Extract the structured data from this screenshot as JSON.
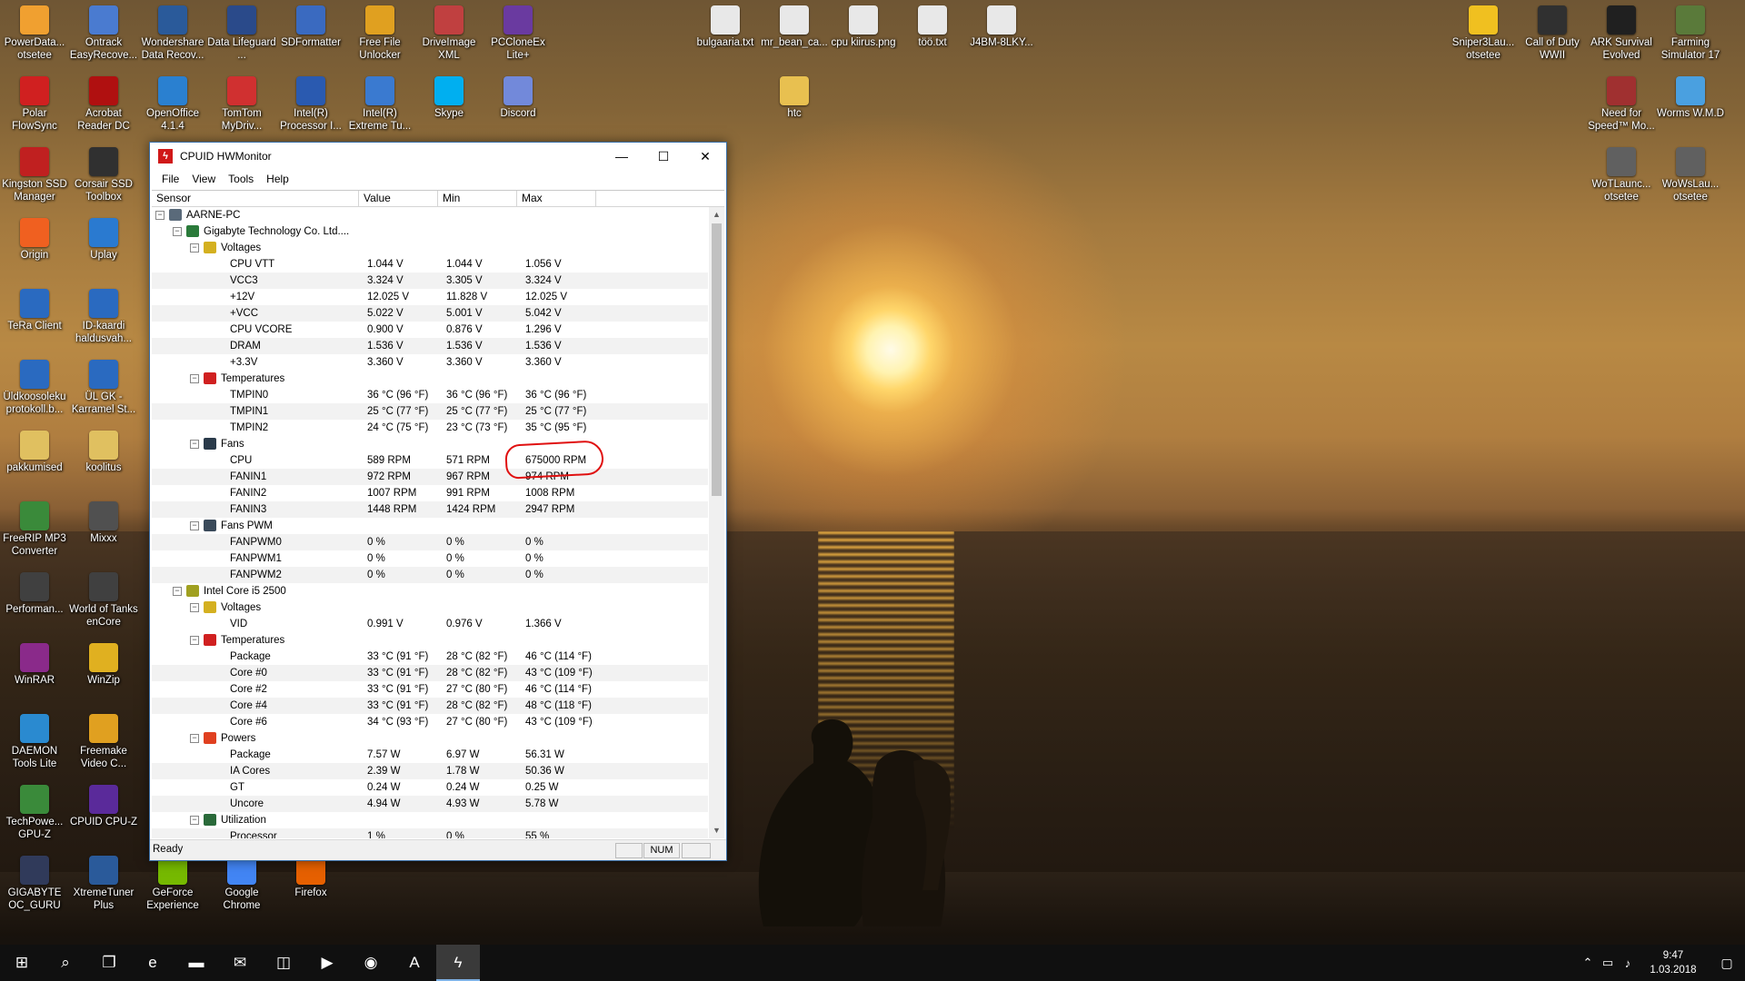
{
  "desktop": {
    "icons": [
      {
        "label": "PowerData... otsetee",
        "icon": "power-data-icon",
        "color": "#f0a030"
      },
      {
        "label": "Ontrack EasyRecove...",
        "icon": "ontrack-icon",
        "color": "#4a7bd0"
      },
      {
        "label": "Wondershare Data Recov...",
        "icon": "wondershare-icon",
        "color": "#2a5a9a"
      },
      {
        "label": "Data Lifeguard ...",
        "icon": "data-lifeguard-icon",
        "color": "#2a4a8a"
      },
      {
        "label": "SDFormatter",
        "icon": "sdformatter-icon",
        "color": "#3a6ac0"
      },
      {
        "label": "Free File Unlocker",
        "icon": "free-file-unlocker-icon",
        "color": "#e0a020"
      },
      {
        "label": "DriveImage XML",
        "icon": "driveimage-icon",
        "color": "#c04040"
      },
      {
        "label": "PCCloneEx Lite+",
        "icon": "pccloneex-icon",
        "color": "#6a3aa0"
      },
      {
        "label": "bulgaaria.txt",
        "icon": "text-file-icon",
        "color": "#e8e8e8"
      },
      {
        "label": "mr_bean_ca...",
        "icon": "document-file-icon",
        "color": "#e8e8e8"
      },
      {
        "label": "cpu kiirus.png",
        "icon": "image-file-icon",
        "color": "#e8e8e8"
      },
      {
        "label": "töö.txt",
        "icon": "text-file-icon",
        "color": "#e8e8e8"
      },
      {
        "label": "J4BM-8LKY...",
        "icon": "text-file-icon",
        "color": "#e8e8e8"
      },
      {
        "label": "Sniper3Lau... otsetee",
        "icon": "sniper-icon",
        "color": "#f0c020"
      },
      {
        "label": "Call of Duty WWII",
        "icon": "call-of-duty-icon",
        "color": "#303030"
      },
      {
        "label": "ARK Survival Evolved",
        "icon": "ark-icon",
        "color": "#202020"
      },
      {
        "label": "Farming Simulator 17",
        "icon": "farming-sim-icon",
        "color": "#5a7a3a"
      },
      {
        "label": "Polar FlowSync",
        "icon": "polar-icon",
        "color": "#d02020"
      },
      {
        "label": "Acrobat Reader DC",
        "icon": "acrobat-icon",
        "color": "#b01010"
      },
      {
        "label": "OpenOffice 4.1.4",
        "icon": "openoffice-icon",
        "color": "#2a80d0"
      },
      {
        "label": "TomTom MyDriv...",
        "icon": "tomtom-icon",
        "color": "#d03030"
      },
      {
        "label": "Intel(R) Processor I...",
        "icon": "intel-icon",
        "color": "#2a5ab0"
      },
      {
        "label": "Intel(R) Extreme Tu...",
        "icon": "intel-xtu-icon",
        "color": "#3a7ad0"
      },
      {
        "label": "Skype",
        "icon": "skype-icon",
        "color": "#00aff0"
      },
      {
        "label": "Discord",
        "icon": "discord-icon",
        "color": "#7289da"
      },
      {
        "label": "htc",
        "icon": "folder-icon",
        "color": "#e8c050"
      },
      {
        "label": "Need for Speed™ Mo...",
        "icon": "nfs-icon",
        "color": "#a03030"
      },
      {
        "label": "Worms W.M.D",
        "icon": "worms-icon",
        "color": "#4aa0e0"
      },
      {
        "label": "Kingston SSD Manager",
        "icon": "kingston-icon",
        "color": "#c02020"
      },
      {
        "label": "Corsair SSD Toolbox",
        "icon": "corsair-icon",
        "color": "#303030"
      },
      {
        "label": "WoTLaunc... otsetee",
        "icon": "wot-icon",
        "color": "#606060"
      },
      {
        "label": "WoWsLau... otsetee",
        "icon": "wows-icon",
        "color": "#606060"
      },
      {
        "label": "Origin",
        "icon": "origin-icon",
        "color": "#f06020"
      },
      {
        "label": "Uplay",
        "icon": "uplay-icon",
        "color": "#2a7ad0"
      },
      {
        "label": "TeRa Client",
        "icon": "id-card-icon",
        "color": "#2a6ac0"
      },
      {
        "label": "ID-kaardi haldusvah...",
        "icon": "id-card-icon",
        "color": "#2a6ac0"
      },
      {
        "label": "Üldkoosoleku protokoll.b...",
        "icon": "id-doc-icon",
        "color": "#2a6ac0"
      },
      {
        "label": "ÜL GK - Karramel St...",
        "icon": "id-doc-icon",
        "color": "#2a6ac0"
      },
      {
        "label": "pakkumised",
        "icon": "archive-icon",
        "color": "#e0c060"
      },
      {
        "label": "koolitus",
        "icon": "folder-icon",
        "color": "#e0c060"
      },
      {
        "label": "FreeRIP MP3 Converter",
        "icon": "freerip-icon",
        "color": "#3a8a3a"
      },
      {
        "label": "Mixxx",
        "icon": "mixxx-icon",
        "color": "#505050"
      },
      {
        "label": "Performan...",
        "icon": "performance-icon",
        "color": "#404040"
      },
      {
        "label": "World of Tanks enCore",
        "icon": "wot-encore-icon",
        "color": "#404040"
      },
      {
        "label": "WinRAR",
        "icon": "winrar-icon",
        "color": "#8a2a8a"
      },
      {
        "label": "WinZip",
        "icon": "winzip-icon",
        "color": "#e0b020"
      },
      {
        "label": "DAEMON Tools Lite",
        "icon": "daemon-tools-icon",
        "color": "#2a8ad0"
      },
      {
        "label": "Freemake Video C...",
        "icon": "freemake-icon",
        "color": "#e0a020"
      },
      {
        "label": "TechPowe... GPU-Z",
        "icon": "gpuz-icon",
        "color": "#3a8a3a"
      },
      {
        "label": "CPUID CPU-Z",
        "icon": "cpuz-icon",
        "color": "#5a2a9a"
      },
      {
        "label": "GIGABYTE OC_GURU",
        "icon": "gigabyte-icon",
        "color": "#303a5a"
      },
      {
        "label": "XtremeTuner Plus",
        "icon": "xtremetuner-icon",
        "color": "#2a5a9a"
      },
      {
        "label": "GeForce Experience",
        "icon": "geforce-icon",
        "color": "#76b900"
      },
      {
        "label": "Google Chrome",
        "icon": "chrome-icon",
        "color": "#4285f4"
      },
      {
        "label": "Firefox",
        "icon": "firefox-icon",
        "color": "#e66000"
      }
    ]
  },
  "window": {
    "title": "CPUID HWMonitor",
    "menu": [
      "File",
      "View",
      "Tools",
      "Help"
    ],
    "columns": [
      "Sensor",
      "Value",
      "Min",
      "Max"
    ],
    "rows": [
      {
        "level": 0,
        "exp": "-",
        "icon": "computer-icon",
        "name": "AARNE-PC",
        "value": "",
        "min": "",
        "max": ""
      },
      {
        "level": 1,
        "exp": "-",
        "icon": "motherboard-icon",
        "name": "Gigabyte Technology Co. Ltd....",
        "value": "",
        "min": "",
        "max": ""
      },
      {
        "level": 2,
        "exp": "-",
        "icon": "voltage-icon",
        "name": "Voltages",
        "value": "",
        "min": "",
        "max": ""
      },
      {
        "level": 3,
        "name": "CPU VTT",
        "value": "1.044 V",
        "min": "1.044 V",
        "max": "1.056 V"
      },
      {
        "level": 3,
        "name": "VCC3",
        "value": "3.324 V",
        "min": "3.305 V",
        "max": "3.324 V"
      },
      {
        "level": 3,
        "name": "+12V",
        "value": "12.025 V",
        "min": "11.828 V",
        "max": "12.025 V"
      },
      {
        "level": 3,
        "name": "+VCC",
        "value": "5.022 V",
        "min": "5.001 V",
        "max": "5.042 V"
      },
      {
        "level": 3,
        "name": "CPU VCORE",
        "value": "0.900 V",
        "min": "0.876 V",
        "max": "1.296 V"
      },
      {
        "level": 3,
        "name": "DRAM",
        "value": "1.536 V",
        "min": "1.536 V",
        "max": "1.536 V"
      },
      {
        "level": 3,
        "name": "+3.3V",
        "value": "3.360 V",
        "min": "3.360 V",
        "max": "3.360 V"
      },
      {
        "level": 2,
        "exp": "-",
        "icon": "thermometer-icon",
        "name": "Temperatures",
        "value": "",
        "min": "",
        "max": ""
      },
      {
        "level": 3,
        "name": "TMPIN0",
        "value": "36 °C  (96 °F)",
        "min": "36 °C  (96 °F)",
        "max": "36 °C  (96 °F)"
      },
      {
        "level": 3,
        "name": "TMPIN1",
        "value": "25 °C  (77 °F)",
        "min": "25 °C  (77 °F)",
        "max": "25 °C  (77 °F)"
      },
      {
        "level": 3,
        "name": "TMPIN2",
        "value": "24 °C  (75 °F)",
        "min": "23 °C  (73 °F)",
        "max": "35 °C  (95 °F)"
      },
      {
        "level": 2,
        "exp": "-",
        "icon": "fan-icon",
        "name": "Fans",
        "value": "",
        "min": "",
        "max": ""
      },
      {
        "level": 3,
        "name": "CPU",
        "value": "589 RPM",
        "min": "571 RPM",
        "max": "675000 RPM"
      },
      {
        "level": 3,
        "name": "FANIN1",
        "value": "972 RPM",
        "min": "967 RPM",
        "max": "974 RPM"
      },
      {
        "level": 3,
        "name": "FANIN2",
        "value": "1007 RPM",
        "min": "991 RPM",
        "max": "1008 RPM"
      },
      {
        "level": 3,
        "name": "FANIN3",
        "value": "1448 RPM",
        "min": "1424 RPM",
        "max": "2947 RPM"
      },
      {
        "level": 2,
        "exp": "-",
        "icon": "fan-pwm-icon",
        "name": "Fans PWM",
        "value": "",
        "min": "",
        "max": ""
      },
      {
        "level": 3,
        "name": "FANPWM0",
        "value": "0 %",
        "min": "0 %",
        "max": "0 %"
      },
      {
        "level": 3,
        "name": "FANPWM1",
        "value": "0 %",
        "min": "0 %",
        "max": "0 %"
      },
      {
        "level": 3,
        "name": "FANPWM2",
        "value": "0 %",
        "min": "0 %",
        "max": "0 %"
      },
      {
        "level": 1,
        "exp": "-",
        "icon": "cpu-chip-icon",
        "name": "Intel Core i5 2500",
        "value": "",
        "min": "",
        "max": ""
      },
      {
        "level": 2,
        "exp": "-",
        "icon": "voltage-icon",
        "name": "Voltages",
        "value": "",
        "min": "",
        "max": ""
      },
      {
        "level": 3,
        "name": "VID",
        "value": "0.991 V",
        "min": "0.976 V",
        "max": "1.366 V"
      },
      {
        "level": 2,
        "exp": "-",
        "icon": "thermometer-icon",
        "name": "Temperatures",
        "value": "",
        "min": "",
        "max": ""
      },
      {
        "level": 3,
        "name": "Package",
        "value": "33 °C  (91 °F)",
        "min": "28 °C  (82 °F)",
        "max": "46 °C  (114 °F)"
      },
      {
        "level": 3,
        "name": "Core #0",
        "value": "33 °C  (91 °F)",
        "min": "28 °C  (82 °F)",
        "max": "43 °C  (109 °F)"
      },
      {
        "level": 3,
        "name": "Core #2",
        "value": "33 °C  (91 °F)",
        "min": "27 °C  (80 °F)",
        "max": "46 °C  (114 °F)"
      },
      {
        "level": 3,
        "name": "Core #4",
        "value": "33 °C  (91 °F)",
        "min": "28 °C  (82 °F)",
        "max": "48 °C  (118 °F)"
      },
      {
        "level": 3,
        "name": "Core #6",
        "value": "34 °C  (93 °F)",
        "min": "27 °C  (80 °F)",
        "max": "43 °C  (109 °F)"
      },
      {
        "level": 2,
        "exp": "-",
        "icon": "power-icon",
        "name": "Powers",
        "value": "",
        "min": "",
        "max": ""
      },
      {
        "level": 3,
        "name": "Package",
        "value": "7.57 W",
        "min": "6.97 W",
        "max": "56.31 W"
      },
      {
        "level": 3,
        "name": "IA Cores",
        "value": "2.39 W",
        "min": "1.78 W",
        "max": "50.36 W"
      },
      {
        "level": 3,
        "name": "GT",
        "value": "0.24 W",
        "min": "0.24 W",
        "max": "0.25 W"
      },
      {
        "level": 3,
        "name": "Uncore",
        "value": "4.94 W",
        "min": "4.93 W",
        "max": "5.78 W"
      },
      {
        "level": 2,
        "exp": "-",
        "icon": "utilization-icon",
        "name": "Utilization",
        "value": "",
        "min": "",
        "max": ""
      },
      {
        "level": 3,
        "name": "Processor",
        "value": "1 %",
        "min": "0 %",
        "max": "55 %"
      }
    ],
    "status": "Ready",
    "status_num": "NUM",
    "icon_colors": {
      "computer-icon": "#5a6a7a",
      "motherboard-icon": "#2a7a3a",
      "voltage-icon": "#d4b020",
      "thermometer-icon": "#d02020",
      "fan-icon": "#2a3a4a",
      "fan-pwm-icon": "#3a4a5a",
      "cpu-chip-icon": "#a0a020",
      "power-icon": "#e04020",
      "utilization-icon": "#2a6a3a"
    },
    "annotation_color": "#e01010"
  },
  "taskbar": {
    "items": [
      {
        "name": "start-button",
        "glyph": "⊞"
      },
      {
        "name": "search-icon",
        "glyph": "⌕"
      },
      {
        "name": "task-view-icon",
        "glyph": "❐"
      },
      {
        "name": "edge-icon",
        "glyph": "e"
      },
      {
        "name": "file-explorer-icon",
        "glyph": "▬"
      },
      {
        "name": "mail-icon",
        "glyph": "✉"
      },
      {
        "name": "store-icon",
        "glyph": "◫"
      },
      {
        "name": "media-player-icon",
        "glyph": "▶"
      },
      {
        "name": "firefox-taskbar-icon",
        "glyph": "◉"
      },
      {
        "name": "acrobat-taskbar-icon",
        "glyph": "A"
      },
      {
        "name": "hwmonitor-taskbar-icon",
        "glyph": "ϟ",
        "active": true
      }
    ],
    "clock_time": "9:47",
    "clock_date": "1.03.2018"
  }
}
